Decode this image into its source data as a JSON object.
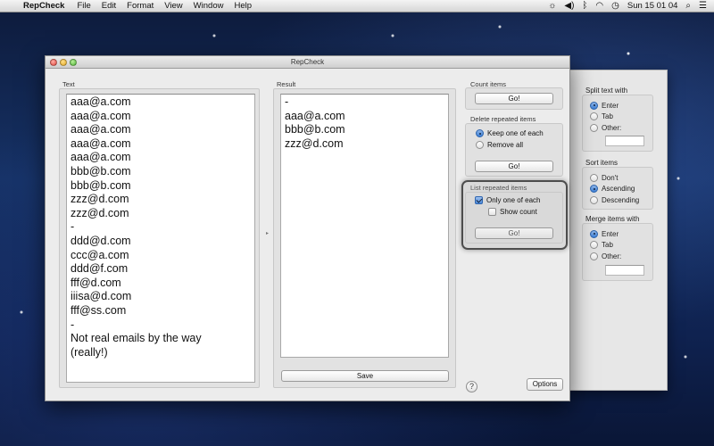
{
  "menubar": {
    "apple_icon": "apple-logo-icon",
    "app_name": "RepCheck",
    "menus": [
      "File",
      "Edit",
      "Format",
      "View",
      "Window",
      "Help"
    ],
    "status_icons": [
      "brightness-icon",
      "volume-icon",
      "bluetooth-icon",
      "wifi-icon",
      "time-machine-icon"
    ],
    "clock": "Sun 15 01 04"
  },
  "window": {
    "title": "RepCheck",
    "text_panel": {
      "label": "Text",
      "lines": [
        "aaa@a.com",
        "aaa@a.com",
        "aaa@a.com",
        "aaa@a.com",
        "aaa@a.com",
        "bbb@b.com",
        "bbb@b.com",
        "zzz@d.com",
        "zzz@d.com",
        "-",
        "ddd@d.com",
        "ccc@a.com",
        "ddd@f.com",
        "fff@d.com",
        "iiisa@d.com",
        "fff@ss.com",
        "-",
        "Not real emails by the way",
        "(really!)"
      ]
    },
    "result_panel": {
      "label": "Result",
      "lines": [
        "-",
        "aaa@a.com",
        "bbb@b.com",
        "zzz@d.com"
      ],
      "save_label": "Save"
    },
    "count": {
      "label": "Count items",
      "go_label": "Go!"
    },
    "delete_repeated": {
      "label": "Delete repeated items",
      "options": [
        {
          "label": "Keep one of each",
          "selected": true
        },
        {
          "label": "Remove all",
          "selected": false
        }
      ],
      "go_label": "Go!"
    },
    "list_repeated": {
      "label": "List repeated items",
      "only_one": {
        "label": "Only one of each",
        "checked": true
      },
      "show_count": {
        "label": "Show count",
        "checked": false
      },
      "go_label": "Go!"
    },
    "help_label": "?",
    "options_label": "Options"
  },
  "drawer": {
    "split": {
      "label": "Split text with",
      "options": [
        {
          "label": "Enter",
          "selected": true
        },
        {
          "label": "Tab",
          "selected": false
        },
        {
          "label": "Other:",
          "selected": false
        }
      ],
      "other_value": ""
    },
    "sort": {
      "label": "Sort items",
      "options": [
        {
          "label": "Don't",
          "selected": false
        },
        {
          "label": "Ascending",
          "selected": true
        },
        {
          "label": "Descending",
          "selected": false
        }
      ]
    },
    "merge": {
      "label": "Merge items with",
      "options": [
        {
          "label": "Enter",
          "selected": true
        },
        {
          "label": "Tab",
          "selected": false
        },
        {
          "label": "Other:",
          "selected": false
        }
      ],
      "other_value": ""
    }
  }
}
